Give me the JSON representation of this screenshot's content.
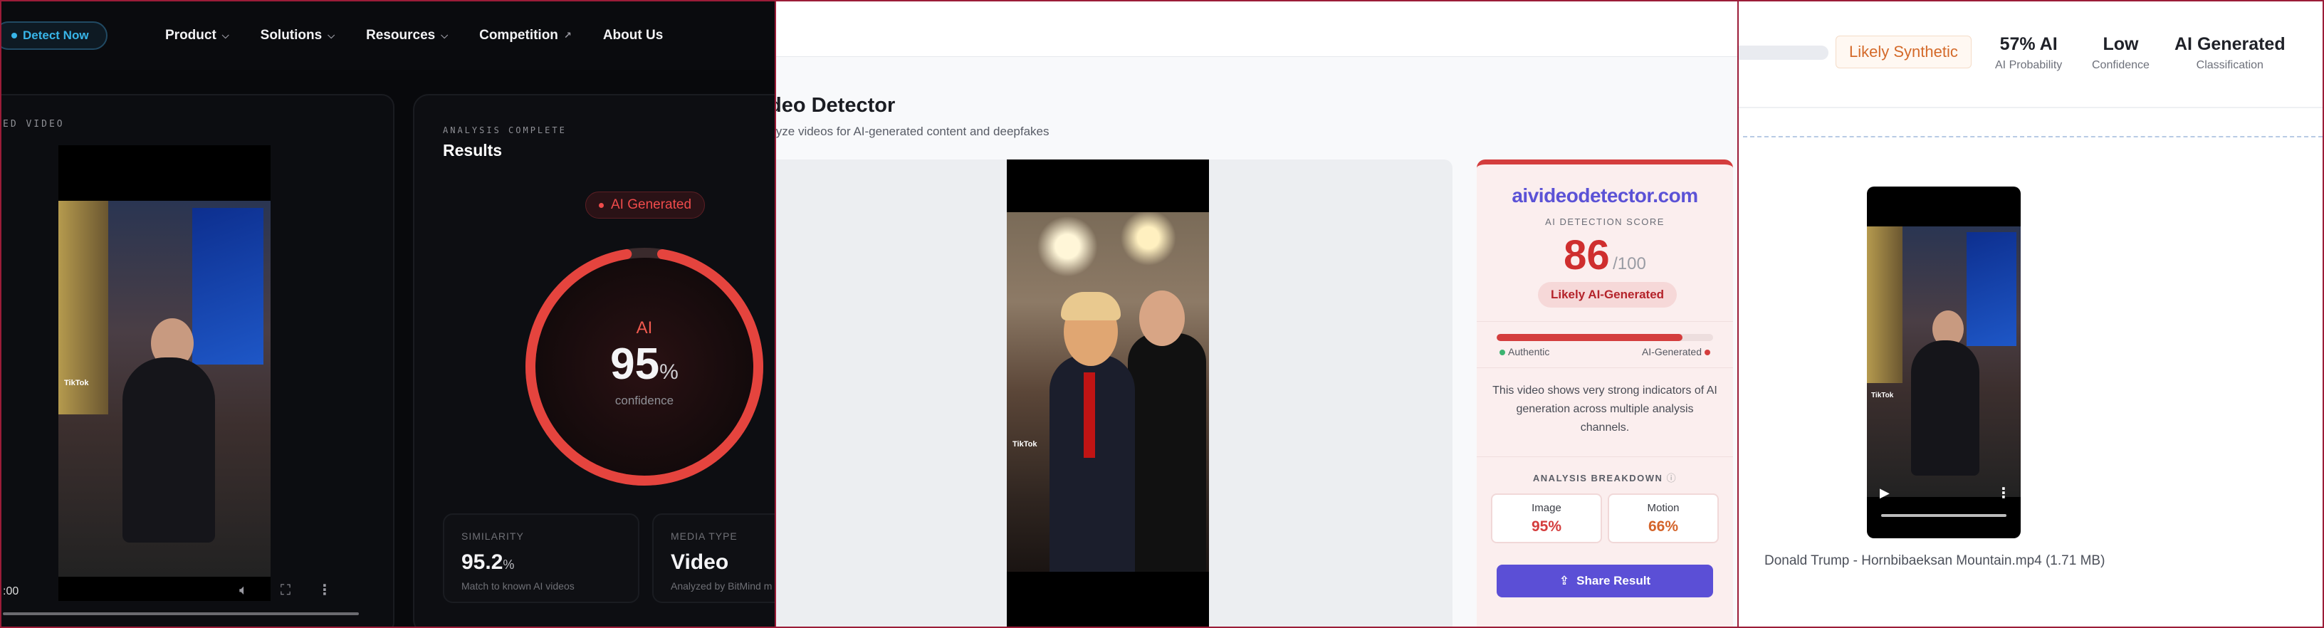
{
  "panel1": {
    "nav": {
      "detect_pill": "Detect Now",
      "items": [
        {
          "label": "Product",
          "suffix": "⌵"
        },
        {
          "label": "Solutions",
          "suffix": "⌵"
        },
        {
          "label": "Resources",
          "suffix": "⌵"
        },
        {
          "label": "Competition",
          "suffix": "↗"
        },
        {
          "label": "About Us",
          "suffix": ""
        }
      ]
    },
    "video_card": {
      "label": "ED VIDEO",
      "watermark": "TikTok",
      "time": ":00"
    },
    "results": {
      "status": "ANALYSIS COMPLETE",
      "title": "Results",
      "badge": "AI Generated",
      "gauge_label": "AI",
      "gauge_value": "95",
      "gauge_unit": "%",
      "gauge_fraction": 0.95,
      "gauge_sub": "confidence",
      "stats": [
        {
          "key": "SIMILARITY",
          "value": "95.2",
          "unit": "%",
          "sub": "Match to known AI videos"
        },
        {
          "key": "MEDIA TYPE",
          "value": "Video",
          "unit": "",
          "sub": "Analyzed by BitMind m"
        }
      ]
    }
  },
  "panel2": {
    "title": "deo Detector",
    "subtitle": "lyze videos for AI-generated content and deepfakes",
    "watermark": "TikTok",
    "brand": "aivideodetector.com",
    "score_label": "AI DETECTION SCORE",
    "score": "86",
    "score_max": "/100",
    "score_fraction": 0.86,
    "verdict": "Likely AI-Generated",
    "meter_left": "Authentic",
    "meter_right": "AI-Generated",
    "description": "This video shows very strong indicators of AI generation across multiple analysis channels.",
    "breakdown_title": "ANALYSIS BREAKDOWN",
    "breakdown": [
      {
        "key": "Image",
        "value": "95%"
      },
      {
        "key": "Motion",
        "value": "66%"
      }
    ],
    "share": "Share Result"
  },
  "panel3": {
    "verdict": "Likely Synthetic",
    "metrics": [
      {
        "value": "57% AI",
        "label": "AI Probability"
      },
      {
        "value": "Low",
        "label": "Confidence"
      },
      {
        "value": "AI Generated",
        "label": "Classification"
      }
    ],
    "watermark": "TikTok",
    "filename": "Donald Trump - Hornbibaeksan Mountain.mp4 (1.71 MB)"
  },
  "colors": {
    "accent_red": "#ef4b4b",
    "brand_purple": "#5b4fd6",
    "share_purple": "#5b4fd6",
    "orange": "#d46a2a",
    "detect_blue": "#38b5e8",
    "panel_border": "#9b1c38"
  }
}
